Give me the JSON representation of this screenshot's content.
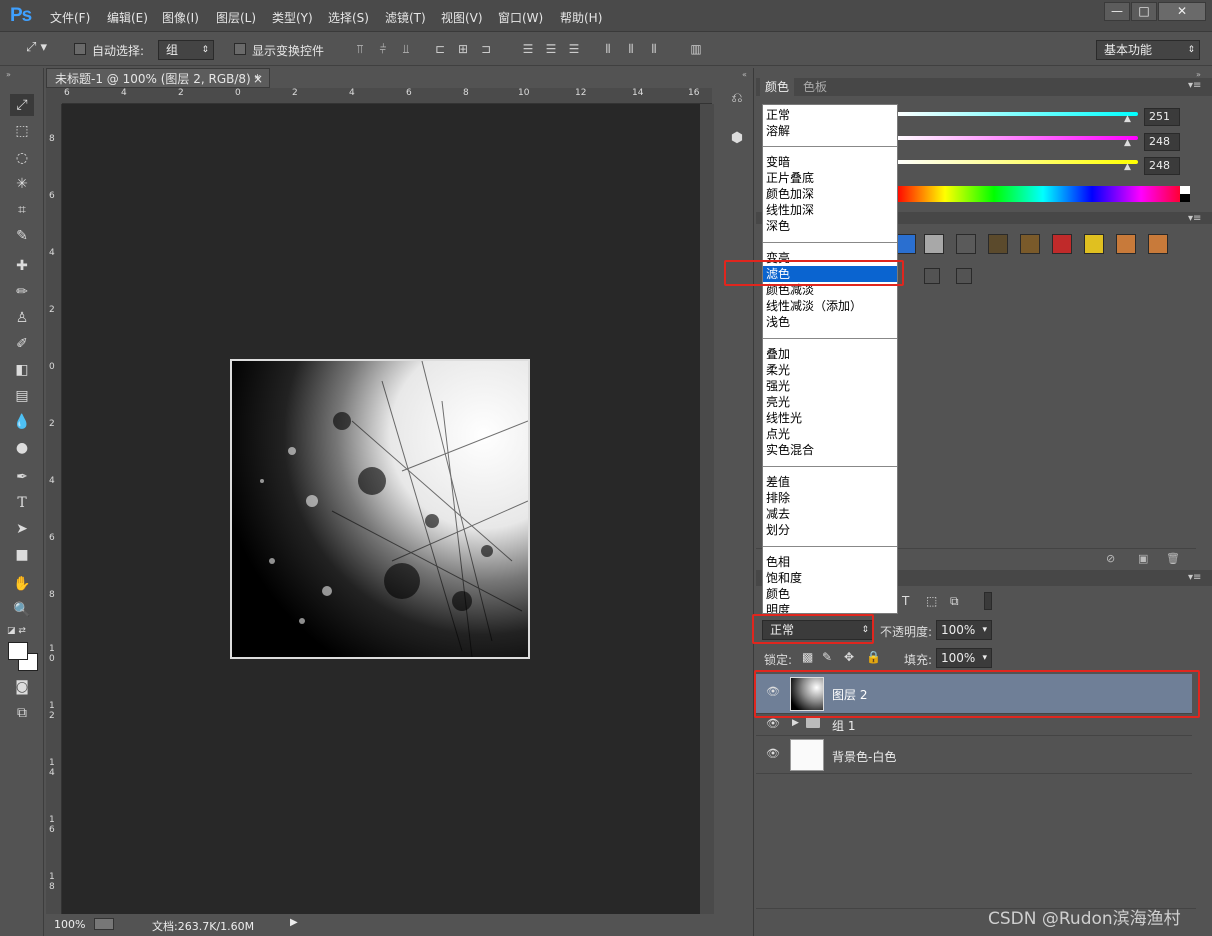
{
  "app": {
    "logo": "Ps"
  },
  "menu": [
    "文件(F)",
    "编辑(E)",
    "图像(I)",
    "图层(L)",
    "类型(Y)",
    "选择(S)",
    "滤镜(T)",
    "视图(V)",
    "窗口(W)",
    "帮助(H)"
  ],
  "window_controls": {
    "minimize": "—",
    "maximize": "□",
    "close": "✕"
  },
  "options": {
    "auto_select_label": "自动选择:",
    "auto_select_value": "组",
    "show_transform_label": "显示变换控件",
    "workspace": "基本功能"
  },
  "document": {
    "tab_title": "未标题-1 @ 100% (图层 2, RGB/8) *",
    "close": "×",
    "ruler_h": [
      "6",
      "4",
      "2",
      "0",
      "2",
      "4",
      "6",
      "8",
      "10",
      "12",
      "14",
      "16"
    ],
    "ruler_v": [
      "8",
      "6",
      "4",
      "2",
      "0",
      "2",
      "4",
      "6",
      "8",
      "1 0",
      "1 2",
      "1 4",
      "1 6",
      "1 8"
    ]
  },
  "status": {
    "zoom": "100%",
    "doc_info": "文档:263.7K/1.60M"
  },
  "color_panel": {
    "tabs": [
      "颜色",
      "色板"
    ],
    "values": [
      "251",
      "248",
      "248"
    ]
  },
  "swatch_colors": [
    "#2a6fd0",
    "#a8a8a8",
    "#5a5a5a",
    "#5b4a2c",
    "#7a5a2a",
    "#c02a2a",
    "#e0c020",
    "#c87a3a"
  ],
  "blend_menu": {
    "groups": [
      [
        "正常",
        "溶解"
      ],
      [
        "变暗",
        "正片叠底",
        "颜色加深",
        "线性加深",
        "深色"
      ],
      [
        "变亮",
        "滤色",
        "颜色减淡",
        "线性减淡（添加）",
        "浅色"
      ],
      [
        "叠加",
        "柔光",
        "强光",
        "亮光",
        "线性光",
        "点光",
        "实色混合"
      ],
      [
        "差值",
        "排除",
        "减去",
        "划分"
      ],
      [
        "色相",
        "饱和度",
        "颜色",
        "明度"
      ]
    ],
    "highlighted": "滤色"
  },
  "layers_panel": {
    "blend_mode": "正常",
    "opacity_label": "不透明度:",
    "opacity_value": "100%",
    "lock_label": "锁定:",
    "fill_label": "填充:",
    "fill_value": "100%",
    "layers": [
      {
        "name": "图层 2",
        "selected": true
      },
      {
        "name": "组 1",
        "selected": false
      },
      {
        "name": "背景色-白色",
        "selected": false
      }
    ]
  },
  "watermark": "CSDN @Rudon滨海渔村"
}
